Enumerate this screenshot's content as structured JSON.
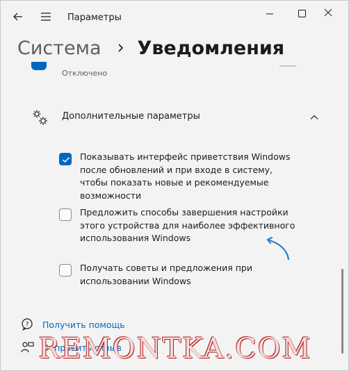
{
  "window": {
    "title": "Параметры"
  },
  "breadcrumb": {
    "parent": "Система",
    "current": "Уведомления"
  },
  "previous_setting": {
    "status": "Отключено"
  },
  "additional": {
    "label": "Дополнительные параметры",
    "expanded": true,
    "options": [
      {
        "text": "Показывать интерфейс приветствия Windows после обновлений и при входе в систему, чтобы показать новые и рекомендуемые возможности",
        "checked": true
      },
      {
        "text": "Предложить способы завершения настройки этого устройства для наиболее эффективного использования Windows",
        "checked": false
      },
      {
        "text": "Получать советы и предложения при использовании Windows",
        "checked": false
      }
    ]
  },
  "footer_links": {
    "help": "Получить помощь",
    "feedback": "Отправить отзыв"
  },
  "watermark": "REMONTKA.COM",
  "colors": {
    "accent": "#0067c0",
    "background": "#f3f3f3",
    "arrow": "#2a7fcb",
    "watermark_outline": "#b21a1a"
  }
}
